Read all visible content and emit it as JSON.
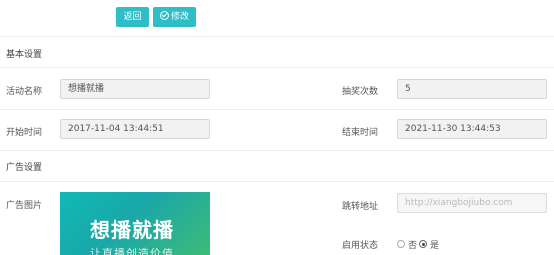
{
  "toolbar": {
    "back_label": "返回",
    "edit_label": "修改"
  },
  "sections": {
    "basic": "基本设置",
    "ad": "广告设置"
  },
  "basic": {
    "name_label": "活动名称",
    "name_value": "想播就播",
    "draws_label": "抽奖次数",
    "draws_value": "5",
    "start_label": "开始时间",
    "start_value": "2017-11-04 13:44:51",
    "end_label": "结束时间",
    "end_value": "2021-11-30 13:44:53"
  },
  "ad": {
    "image_label": "广告图片",
    "banner_title": "想播就播",
    "banner_subtitle": "让直播创造价值",
    "url_label": "跳转地址",
    "url_placeholder": "http://xiangbojiubo.com",
    "status_label": "启用状态",
    "status_options": [
      "否",
      "是"
    ],
    "status_selected": "是"
  },
  "colors": {
    "accent": "#2fbdc6"
  }
}
